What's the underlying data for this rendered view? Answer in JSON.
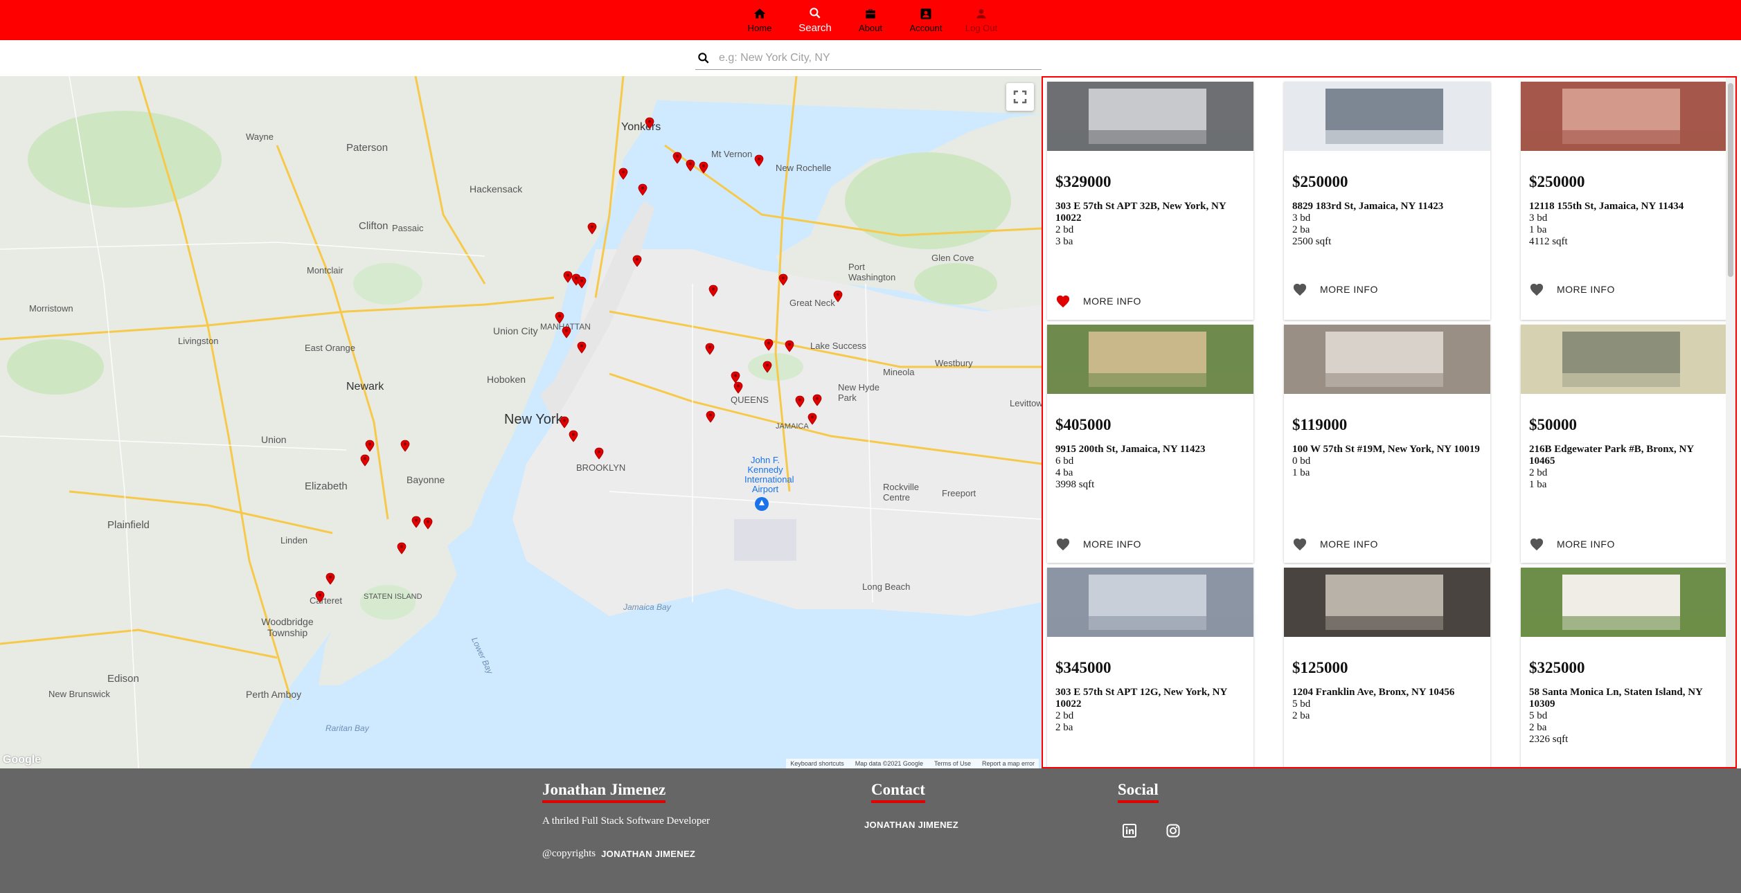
{
  "nav": {
    "items": [
      {
        "label": "Home",
        "icon": "home-icon"
      },
      {
        "label": "Search",
        "icon": "search-icon"
      },
      {
        "label": "About",
        "icon": "briefcase-icon"
      },
      {
        "label": "Account",
        "icon": "account-icon"
      },
      {
        "label": "Log Out",
        "icon": "person-icon"
      }
    ],
    "active": "Search",
    "colors": {
      "bar": "#ff0000",
      "active_text": "#ffffff"
    }
  },
  "search": {
    "placeholder": "e.g: New York City, NY",
    "value": ""
  },
  "map": {
    "labels": {
      "new_york": "New York",
      "newark": "Newark",
      "yonkers": "Yonkers",
      "paterson": "Paterson",
      "clifton": "Clifton",
      "passaic": "Passaic",
      "hackensack": "Hackensack",
      "elizabeth": "Elizabeth",
      "bayonne": "Bayonne",
      "union_city": "Union City",
      "hoboken": "Hoboken",
      "queens": "QUEENS",
      "brooklyn": "BROOKLYN",
      "manhattan": "MANHATTAN",
      "jamaica": "JAMAICA",
      "edison": "Edison",
      "perth_amboy": "Perth Amboy",
      "woodbridge": "Woodbridge Township",
      "new_brunswick": "New Brunswick",
      "westbury": "Westbury",
      "new_hyde_park": "New Hyde Park",
      "mineola": "Mineola",
      "long_beach": "Long Beach",
      "airport": "John F. Kennedy International Airport",
      "jamaica_bay": "Jamaica Bay",
      "raritan_bay": "Raritan Bay",
      "lower_bay": "Lower Bay",
      "staten_island": "STATEN ISLAND",
      "plainfield": "Plainfield",
      "montclair": "Montclair",
      "morristown": "Morristown",
      "wayne": "Wayne",
      "livingston": "Livingston",
      "east_orange": "East Orange",
      "union": "Union",
      "linden": "Linden",
      "carteret": "Carteret",
      "mt_vernon": "Mt Vernon",
      "new_rochelle": "New Rochelle",
      "rockville_centre": "Rockville Centre",
      "freeport": "Freeport",
      "levittown": "Levittown",
      "glen_cove": "Glen Cove",
      "port_washington": "Port Washington",
      "great_neck": "Great Neck",
      "lake_success": "Lake Success"
    },
    "attribution": [
      "Keyboard shortcuts",
      "Map data ©2021 Google",
      "Terms of Use",
      "Report a map error"
    ],
    "logo": "Google",
    "zoom_in": "+",
    "zoom_out": "−",
    "pin_color": "#e00000"
  },
  "listings": [
    {
      "price": "$329000",
      "address": "303 E 57th St APT 32B, New York, NY 10022",
      "specs": [
        "2 bd",
        "3 ba"
      ],
      "favorite": true,
      "action": "MORE INFO"
    },
    {
      "price": "$250000",
      "address": "8829 183rd St, Jamaica, NY 11423",
      "specs": [
        "3 bd",
        "2 ba",
        "2500 sqft"
      ],
      "favorite": false,
      "action": "MORE INFO"
    },
    {
      "price": "$250000",
      "address": "12118 155th St, Jamaica, NY 11434",
      "specs": [
        "3 bd",
        "1 ba",
        "4112 sqft"
      ],
      "favorite": false,
      "action": "MORE INFO"
    },
    {
      "price": "$405000",
      "address": "9915 200th St, Jamaica, NY 11423",
      "specs": [
        "6 bd",
        "4 ba",
        "3998 sqft"
      ],
      "favorite": false,
      "action": "MORE INFO"
    },
    {
      "price": "$119000",
      "address": "100 W 57th St #19M, New York, NY 10019",
      "specs": [
        "0 bd",
        "1 ba"
      ],
      "favorite": false,
      "action": "MORE INFO"
    },
    {
      "price": "$50000",
      "address": "216B Edgewater Park #B, Bronx, NY 10465",
      "specs": [
        "2 bd",
        "1 ba"
      ],
      "favorite": false,
      "action": "MORE INFO"
    },
    {
      "price": "$345000",
      "address": "303 E 57th St APT 12G, New York, NY 10022",
      "specs": [
        "2 bd",
        "2 ba"
      ],
      "favorite": false,
      "action": "MORE INFO"
    },
    {
      "price": "$125000",
      "address": "1204 Franklin Ave, Bronx, NY 10456",
      "specs": [
        "5 bd",
        "2 ba"
      ],
      "favorite": false,
      "action": "MORE INFO"
    },
    {
      "price": "$325000",
      "address": "58 Santa Monica Ln, Staten Island, NY 10309",
      "specs": [
        "5 bd",
        "2 ba",
        "2326 sqft"
      ],
      "favorite": false,
      "action": "MORE INFO"
    }
  ],
  "footer": {
    "about": {
      "heading": "Jonathan Jimenez",
      "tagline": "A thriled Full Stack Software Developer",
      "copyright_prefix": "@copyrights",
      "copyright_name": "JONATHAN JIMENEZ"
    },
    "contact": {
      "heading": "Contact",
      "name": "JONATHAN JIMENEZ"
    },
    "social": {
      "heading": "Social",
      "icons": [
        "linkedin-icon",
        "instagram-icon"
      ]
    },
    "colors": {
      "background": "#666666",
      "underline": "#e00000"
    }
  }
}
